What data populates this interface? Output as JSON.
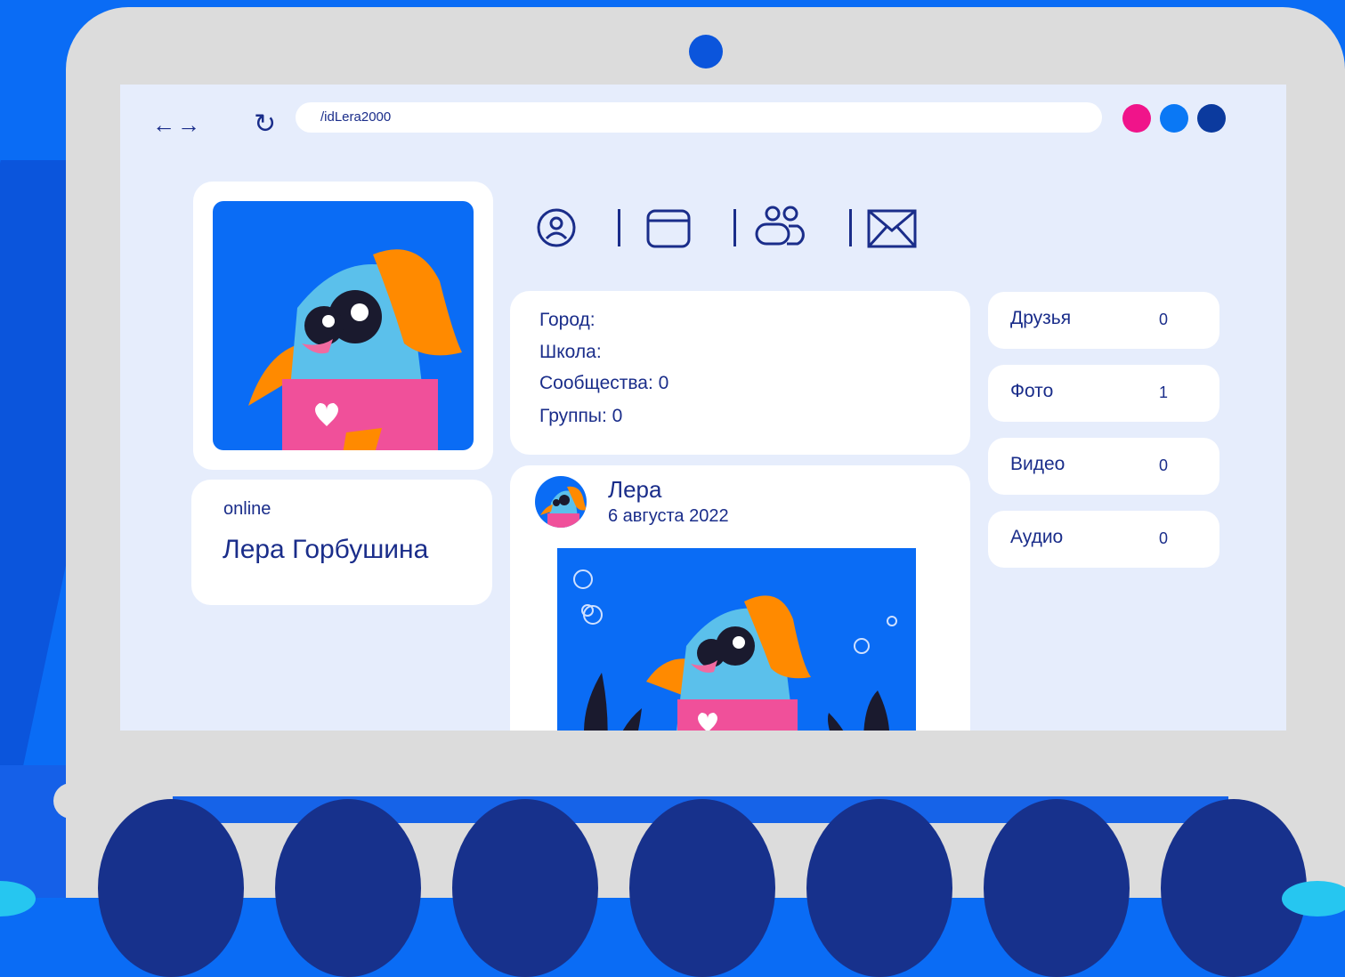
{
  "browser": {
    "nav_arrows": "←→",
    "reload_icon": "↻",
    "url": "/idLera2000",
    "window_dots": [
      "#f0148a",
      "#0a78f5",
      "#0b3a9e"
    ]
  },
  "profile": {
    "status": "online",
    "name": "Лера Горбушина"
  },
  "nav_icons": [
    "user-icon",
    "window-icon",
    "friends-icon",
    "mail-icon"
  ],
  "info": {
    "city": "Город:",
    "school": "Школа:",
    "communities": "Сообщества:  0",
    "groups": "Группы:  0"
  },
  "post": {
    "author": "Лера",
    "date": "6 августа 2022"
  },
  "stats": [
    {
      "label": "Друзья",
      "value": "0"
    },
    {
      "label": "Фото",
      "value": "1"
    },
    {
      "label": "Видео",
      "value": "0"
    },
    {
      "label": "Аудио",
      "value": "0"
    }
  ],
  "colors": {
    "background": "#0a6cf5",
    "laptop": "#dcdcdc",
    "screen": "#e6edfc",
    "text": "#1a2d8a",
    "fish_body": "#5bc0eb",
    "fish_hair": "#ff8a00",
    "fish_shirt": "#f0509a"
  }
}
